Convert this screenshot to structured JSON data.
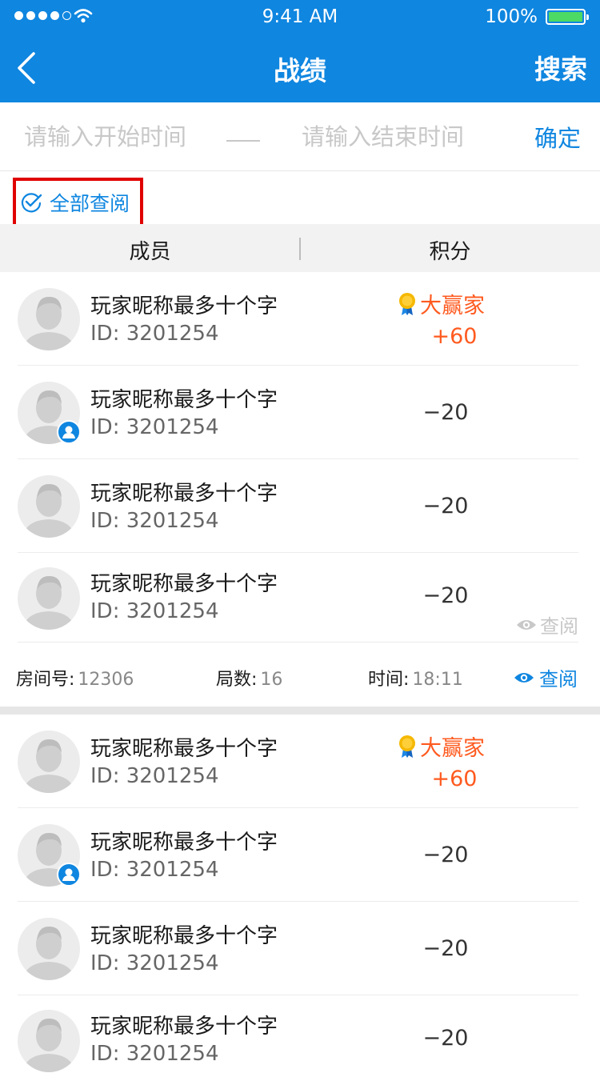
{
  "status_bar": {
    "time": "9:41 AM",
    "battery": "100%",
    "signal_bars_filled": 4,
    "signal_bars_total": 5
  },
  "nav": {
    "title": "战绩",
    "search_label": "搜索",
    "back_icon": "chevron-left-icon"
  },
  "filter": {
    "start_placeholder": "请输入开始时间",
    "end_placeholder": "请输入结束时间",
    "start_value": "",
    "end_value": "",
    "confirm_label": "确定"
  },
  "view_all_label": "全部查阅",
  "table_header": {
    "member": "成员",
    "score": "积分"
  },
  "colors": {
    "brand": "#0f86e0",
    "winner": "#ff5a1f",
    "highlight_box": "#e00000"
  },
  "groups": [
    {
      "rows": [
        {
          "name": "玩家昵称最多十个字",
          "id": "ID: 3201254",
          "score": "+60",
          "winner": true,
          "winner_label": "大赢家",
          "has_role_badge": false,
          "review_label": ""
        },
        {
          "name": "玩家昵称最多十个字",
          "id": "ID: 3201254",
          "score": "−20",
          "winner": false,
          "has_role_badge": true,
          "review_label": ""
        },
        {
          "name": "玩家昵称最多十个字",
          "id": "ID: 3201254",
          "score": "−20",
          "winner": false,
          "has_role_badge": false,
          "review_label": ""
        },
        {
          "name": "玩家昵称最多十个字",
          "id": "ID: 3201254",
          "score": "−20",
          "winner": false,
          "has_role_badge": false,
          "review_label": "查阅"
        }
      ],
      "footer": {
        "room_label": "房间号:",
        "room_value": "12306",
        "rounds_label": "局数:",
        "rounds_value": "16",
        "time_label": "时间:",
        "time_value": "18:11",
        "review_label": "查阅"
      }
    },
    {
      "rows": [
        {
          "name": "玩家昵称最多十个字",
          "id": "ID: 3201254",
          "score": "+60",
          "winner": true,
          "winner_label": "大赢家",
          "has_role_badge": false,
          "review_label": ""
        },
        {
          "name": "玩家昵称最多十个字",
          "id": "ID: 3201254",
          "score": "−20",
          "winner": false,
          "has_role_badge": true,
          "review_label": ""
        },
        {
          "name": "玩家昵称最多十个字",
          "id": "ID: 3201254",
          "score": "−20",
          "winner": false,
          "has_role_badge": false,
          "review_label": ""
        },
        {
          "name": "玩家昵称最多十个字",
          "id": "ID: 3201254",
          "score": "−20",
          "winner": false,
          "has_role_badge": false,
          "review_label": ""
        }
      ]
    }
  ]
}
